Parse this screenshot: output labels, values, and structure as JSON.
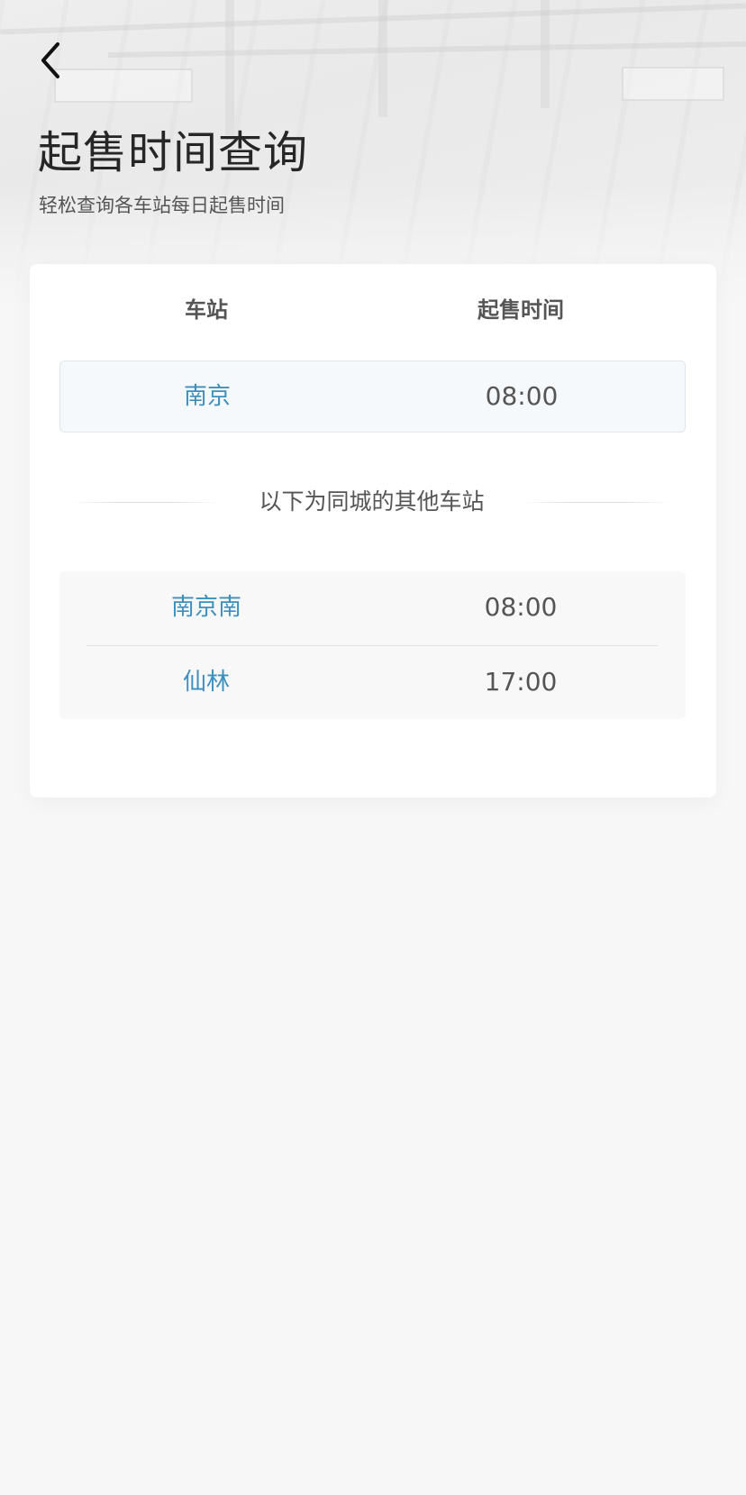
{
  "header": {
    "back_icon": "chevron-left-icon",
    "title": "起售时间查询",
    "subtitle": "轻松查询各车站每日起售时间"
  },
  "table": {
    "columns": [
      "车站",
      "起售时间"
    ],
    "primary": {
      "station": "南京",
      "time": "08:00"
    },
    "divider_text": "以下为同城的其他车站",
    "others": [
      {
        "station": "南京南",
        "time": "08:00"
      },
      {
        "station": "仙林",
        "time": "17:00"
      }
    ]
  },
  "colors": {
    "station_link": "#3d8fbd",
    "page_bg": "#f7f7f7",
    "card_bg": "#ffffff",
    "primary_row_bg": "#f6f9fc"
  }
}
